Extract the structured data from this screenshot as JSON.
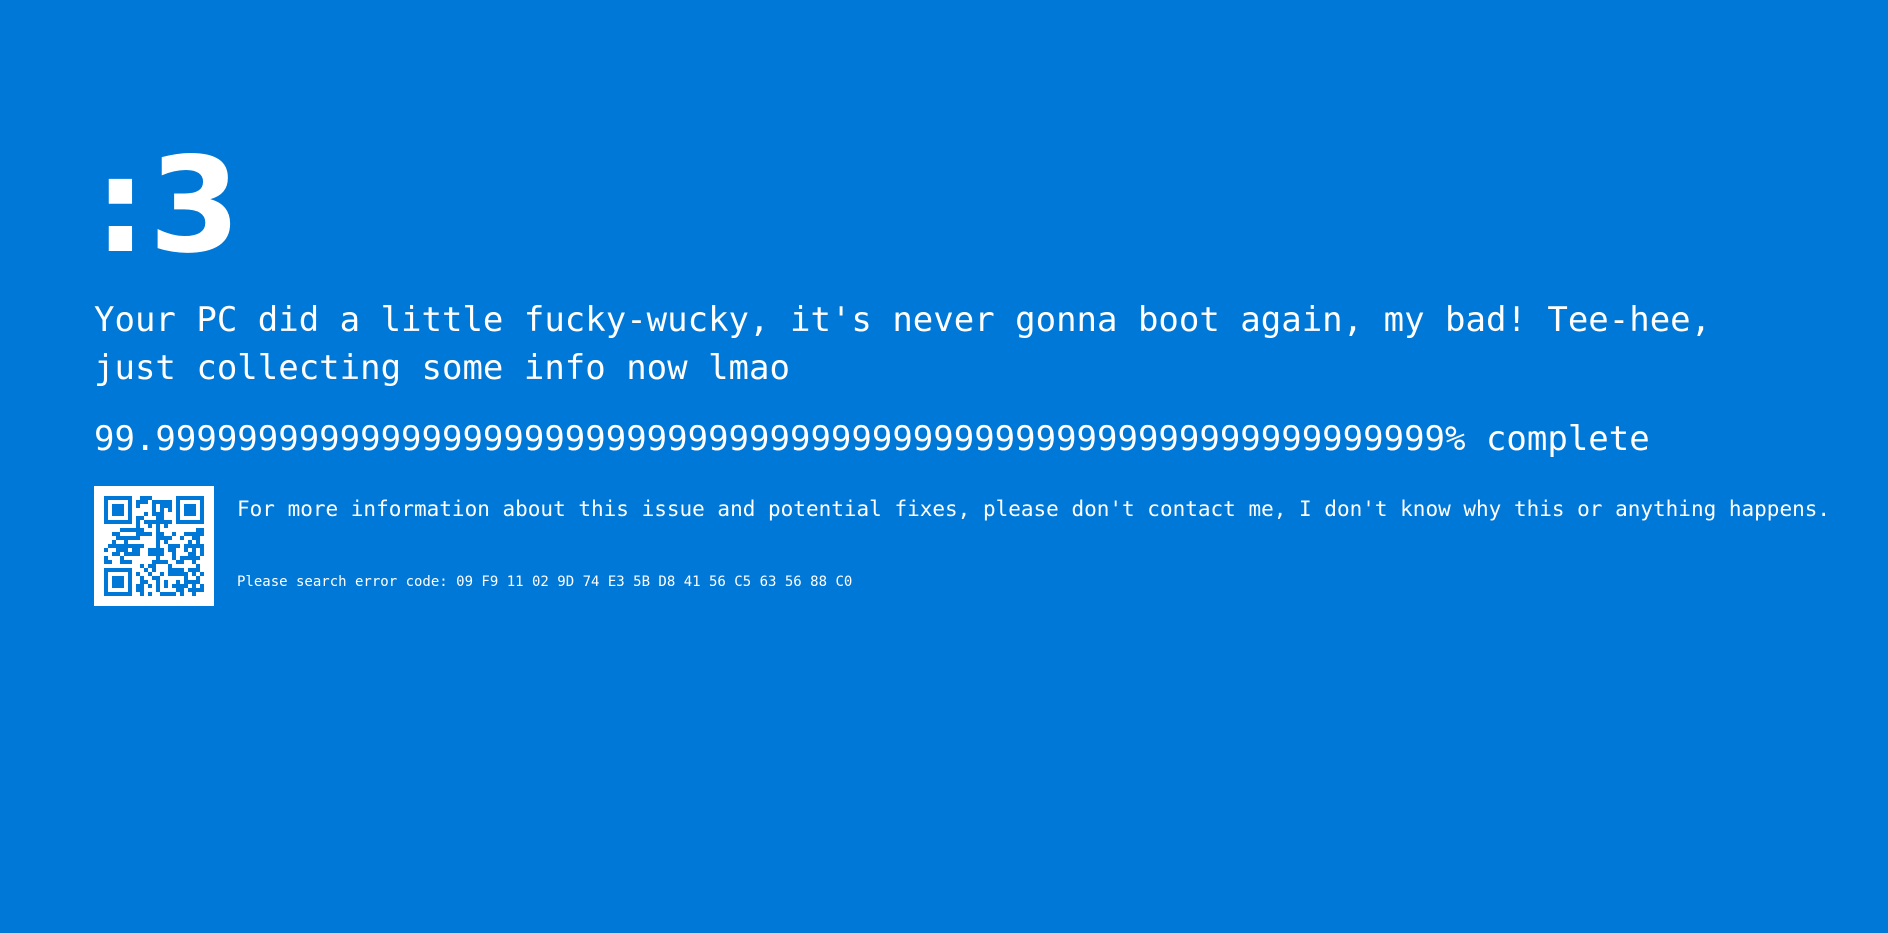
{
  "screen": {
    "background_color": "#0078d7",
    "text_color": "#ffffff",
    "face": ":3",
    "message": "Your PC did a little fucky-wucky, it's never gonna boot again, my bad! Tee-hee, just collecting some info now lmao",
    "progress_text": "99.999999999999999999999999999999999999999999999999999999999999999% complete",
    "qr_icon": "qr-code-icon",
    "more_info": "For more information about this issue and potential fixes, please don't contact me, I don't know why this or anything happens.",
    "error_code": "Please search error code: 09 F9 11 02 9D 74 E3 5B D8 41 56 C5 63 56 88 C0"
  }
}
